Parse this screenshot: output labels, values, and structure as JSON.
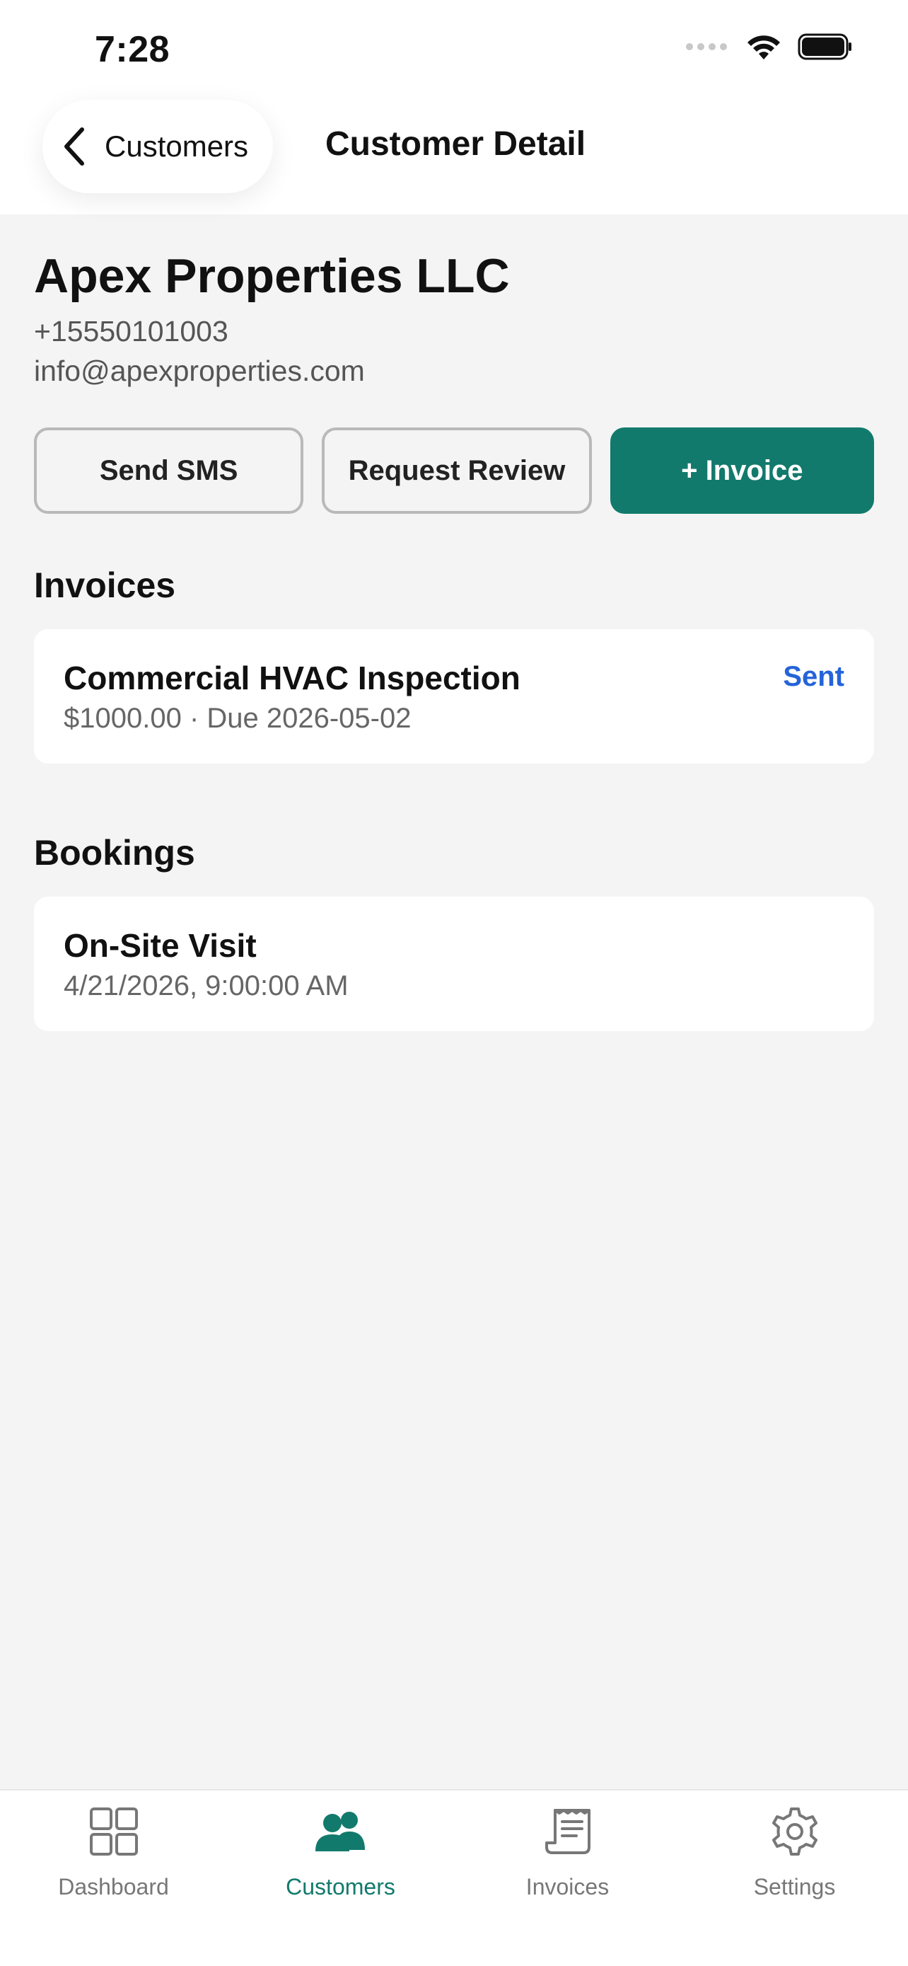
{
  "status_bar": {
    "time": "7:28"
  },
  "nav": {
    "back_label": "Customers",
    "title": "Customer Detail"
  },
  "customer": {
    "name": "Apex Properties LLC",
    "phone": "+15550101003",
    "email": "info@apexproperties.com"
  },
  "actions": {
    "send_sms": "Send SMS",
    "request_review": "Request Review",
    "add_invoice": "+ Invoice"
  },
  "invoices": {
    "heading": "Invoices",
    "items": [
      {
        "title": "Commercial HVAC Inspection",
        "subtitle": "$1000.00 · Due 2026-05-02",
        "status": "Sent"
      }
    ]
  },
  "bookings": {
    "heading": "Bookings",
    "items": [
      {
        "title": "On-Site Visit",
        "subtitle": "4/21/2026, 9:00:00 AM"
      }
    ]
  },
  "tabs": [
    {
      "label": "Dashboard",
      "icon": "grid-icon"
    },
    {
      "label": "Customers",
      "icon": "users-icon",
      "active": true
    },
    {
      "label": "Invoices",
      "icon": "receipt-icon"
    },
    {
      "label": "Settings",
      "icon": "gear-icon"
    }
  ],
  "colors": {
    "accent": "#127a6c",
    "status_sent": "#2563d9",
    "background": "#f4f4f4"
  }
}
